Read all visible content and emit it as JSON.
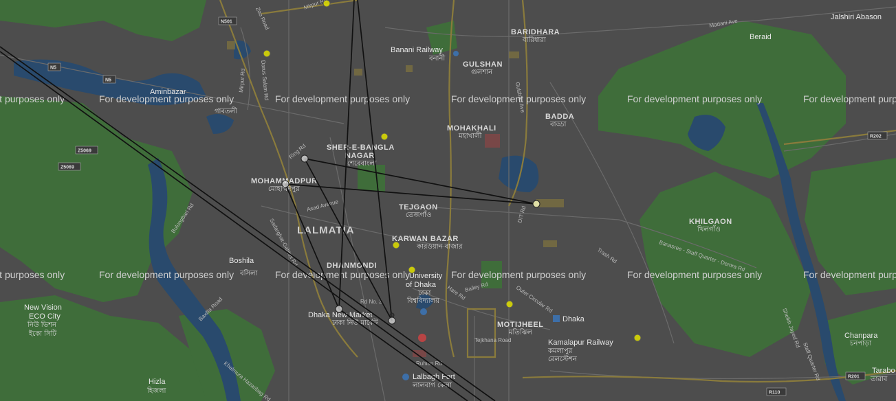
{
  "map": {
    "watermark_text": "For development purposes only",
    "colors": {
      "land": "#4d4d4d",
      "park": "#3e7a3a",
      "water": "#2a4a6e",
      "road_major": "#8a7a3a",
      "road_minor": "#6a6a6a",
      "route_line": "#111111",
      "marker_yellow": "#e6e600",
      "marker_white": "#e8e8e8"
    },
    "area_labels": [
      {
        "en": "BARIDHARA",
        "bn": "বারিধারা"
      },
      {
        "en": "GULSHAN",
        "bn": "গুলশান"
      },
      {
        "en": "MOHAKHALI",
        "bn": "মহাখালী"
      },
      {
        "en": "BADDA",
        "bn": "বাড্ডা"
      },
      {
        "en": "SHER-E-BANGLA",
        "bn": ""
      },
      {
        "en": "NAGAR",
        "bn": "শেরেবাংলা"
      },
      {
        "en": "MOHAMMADPUR",
        "bn": "মোহাম্মদপুর"
      },
      {
        "en": "TEJGAON",
        "bn": "তেজগাঁও"
      },
      {
        "en": "LALMATIA",
        "bn": ""
      },
      {
        "en": "KARWAN BAZAR",
        "bn": "কারওয়ান বাজার"
      },
      {
        "en": "DHANMONDI",
        "bn": ""
      },
      {
        "en": "KHILGAON",
        "bn": "খিলগাঁও"
      },
      {
        "en": "MOTIJHEEL",
        "bn": "মতিঝিল"
      }
    ],
    "place_labels": [
      {
        "en": "Banani Railway",
        "bn": "বনানী"
      },
      {
        "en": "Aminbazar",
        "bn": ""
      },
      {
        "en": "Boshila",
        "bn": "বসিলা"
      },
      {
        "en": "New Vision",
        "bn": ""
      },
      {
        "en": "ECO City",
        "bn": "নিউ ভিশন"
      },
      {
        "en": "",
        "bn": "ইকো সিটি"
      },
      {
        "en": "Hizla",
        "bn": "হিজলা"
      },
      {
        "en": "Dhaka New Market",
        "bn": "ঢাকা নিউ মার্কেট"
      },
      {
        "en": "University",
        "bn": ""
      },
      {
        "en": "of Dhaka",
        "bn": "ঢাকা"
      },
      {
        "en": "",
        "bn": "বিশ্ববিদ্যালয়"
      },
      {
        "en": "Dhaka",
        "bn": ""
      },
      {
        "en": "Kamalapur Railway",
        "bn": "কমলাপুর"
      },
      {
        "en": "",
        "bn": "রেলস্টেশন"
      },
      {
        "en": "Lalbagh Fort",
        "bn": "লালবাগ কেল্লা"
      },
      {
        "en": "Beraid",
        "bn": ""
      },
      {
        "en": "Jalshiri Abason",
        "bn": ""
      },
      {
        "en": "Chanpara",
        "bn": "চনপাড়া"
      },
      {
        "en": "Tarabo",
        "bn": "তারাব"
      },
      {
        "en": "",
        "bn": "গাবতলী"
      }
    ],
    "road_labels": [
      "Mirpur Rd",
      "Mirpur Rd",
      "Zoo Road",
      "Darus Salam Rd",
      "Madani Ave",
      "Ring Rd",
      "Asad Avenue",
      "Sadarghat-Gabtoli Rd",
      "Hare Rd",
      "Bailey Rd",
      "Outer Circular Rd",
      "Tejkhana Road",
      "Rd No. 2",
      "Banasree - Staff Quarter - Demra Rd",
      "Sheikh Jayed Rd",
      "Staff Quarter Rd",
      "Trash Rd",
      "DIT Rd",
      "Gulshan Ave",
      "Bulungbari Rd",
      "Khalmura Hazaribag Rd",
      "Baxilla Road",
      "Ruhian Rd"
    ],
    "route_shields": [
      "N501",
      "N5",
      "N5",
      "Z5069",
      "Z5069",
      "R202",
      "R201",
      "R110"
    ],
    "markers_yellow_count": 8,
    "markers_white_count": 6
  }
}
